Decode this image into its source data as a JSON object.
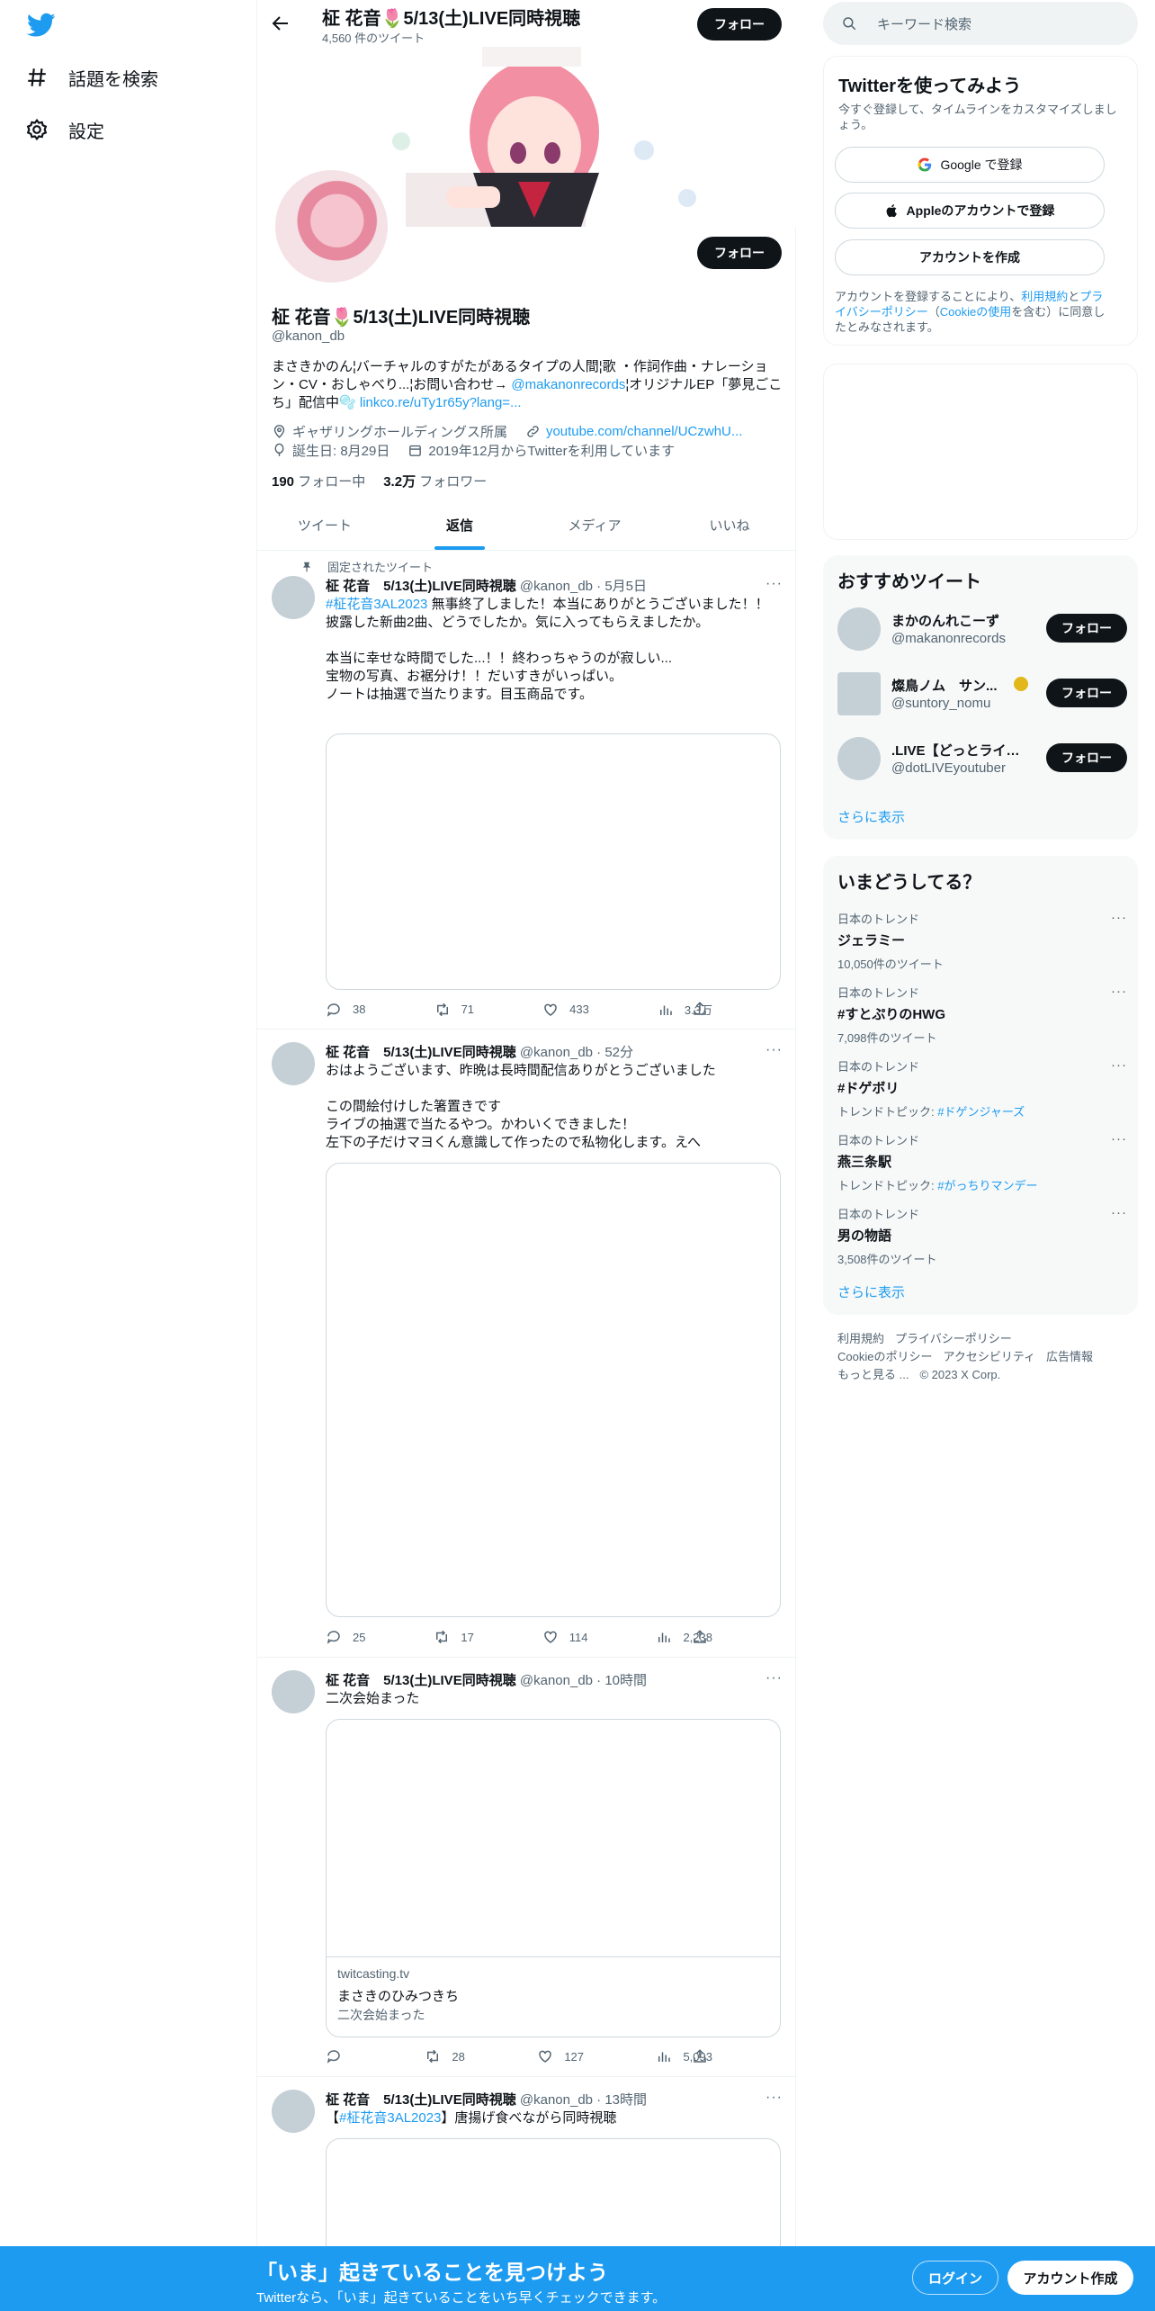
{
  "nav": {
    "explore_label": "話題を検索",
    "settings_label": "設定"
  },
  "header": {
    "name": "柾 花音🌷5/13(土)LIVE同時視聴",
    "tweet_count": "4,560 件のツイート",
    "follow_label": "フォロー"
  },
  "profile": {
    "follow_label": "フォロー",
    "name": "柾 花音🌷5/13(土)LIVE同時視聴",
    "handle": "@kanon_db",
    "bio_1": "まさきかのん¦バーチャルのすがたがあるタイプの人間¦歌 ・作詞作曲・ナレーション・CV・おしゃべり...¦お問い合わせ→ ",
    "bio_mention": "@makanonrecords",
    "bio_2": "¦オリジナルEP「夢見ごこち」配信中🫧 ",
    "bio_link": "linkco.re/uTy1r65y?lang=...",
    "location": "ギャザリングホールディングス所属",
    "website": "youtube.com/channel/UCzwhU...",
    "birthday": "誕生日: 8月29日",
    "joined": "2019年12月からTwitterを利用しています",
    "following_count": "190",
    "following_label": "フォロー中",
    "followers_count": "3.2万",
    "followers_label": "フォロワー"
  },
  "tabs": [
    {
      "label": "ツイート"
    },
    {
      "label": "返信"
    },
    {
      "label": "メディア"
    },
    {
      "label": "いいね"
    }
  ],
  "tweets": [
    {
      "pinned_label": "固定されたツイート",
      "name": "柾 花音　5/13(土)LIVE同時視聴",
      "meta": "@kanon_db · 5月5日",
      "hashtag": "#柾花音3AL2023",
      "body_first": " 無事終了しました！本当にありがとうございました！！",
      "body": "\n披露した新曲2曲、どうでしたか。気に入ってもらえましたか。\n\n本当に幸せな時間でした...！！終わっちゃうのが寂しい...\n宝物の写真、お裾分け！！だいすきがいっぱい。\nノートは抽選で当たります。目玉商品です。",
      "replies": "38",
      "retweets": "71",
      "likes": "433",
      "views": "3.3万"
    },
    {
      "name": "柾 花音　5/13(土)LIVE同時視聴",
      "meta": "@kanon_db · 52分",
      "body": "おはようございます、昨晩は長時間配信ありがとうございました\n\nこの間絵付けした箸置きです\nライブの抽選で当たるやつ。かわいくできました！\n左下の子だけマヨくん意識して作ったので私物化します。えへ",
      "replies": "25",
      "retweets": "17",
      "likes": "114",
      "views": "2,238"
    },
    {
      "name": "柾 花音　5/13(土)LIVE同時視聴",
      "meta": "@kanon_db · 10時間",
      "body": "二次会始まった",
      "card_domain": "twitcasting.tv",
      "card_title": "まさきのひみつきち",
      "card_desc": "二次会始まった",
      "replies": "",
      "retweets": "28",
      "likes": "127",
      "views": "5,093"
    },
    {
      "name": "柾 花音　5/13(土)LIVE同時視聴",
      "meta": "@kanon_db · 13時間",
      "body_pre": "【",
      "hashtag": "#柾花音3AL2023",
      "body_post": "】唐揚げ食べながら同時視聴"
    }
  ],
  "search": {
    "placeholder": "キーワード検索"
  },
  "signup": {
    "title": "Twitterを使ってみよう",
    "subtitle": "今すぐ登録して、タイムラインをカスタマイズしましょう。",
    "google_label": "Google で登録",
    "apple_label": "Appleのアカウントで登録",
    "create_label": "アカウントを作成",
    "terms_pre": "アカウントを登録することにより、",
    "terms_link1": "利用規約",
    "terms_mid1": "と",
    "terms_link2": "プライバシーポリシー",
    "terms_mid2": "（",
    "terms_link3": "Cookieの使用",
    "terms_post": "を含む）に同意したとみなされます。"
  },
  "recommend": {
    "title": "おすすめツイート",
    "users": [
      {
        "name": "まかのんれこーず",
        "handle": "@makanonrecords",
        "follow": "フォロー"
      },
      {
        "name": "燦鳥ノム　サン...",
        "handle": "@suntory_nomu",
        "follow": "フォロー"
      },
      {
        "name": ".LIVE【どっとライブ...",
        "handle": "@dotLIVEyoutuber",
        "follow": "フォロー"
      }
    ],
    "show_more": "さらに表示"
  },
  "trends": {
    "title": "いまどうしてる？",
    "items": [
      {
        "category": "日本のトレンド",
        "title": "ジェラミー",
        "sub": "10,050件のツイート"
      },
      {
        "category": "日本のトレンド",
        "title": "#すとぷりのHWG",
        "sub": "7,098件のツイート"
      },
      {
        "category": "日本のトレンド",
        "title": "#ドゲボリ",
        "sub_pre": "トレンドトピック: ",
        "sub_link": "#ドゲンジャーズ"
      },
      {
        "category": "日本のトレンド",
        "title": "燕三条駅",
        "sub_pre": "トレンドトピック: ",
        "sub_link": "#がっちりマンデー"
      },
      {
        "category": "日本のトレンド",
        "title": "男の物語",
        "sub": "3,508件のツイート"
      }
    ],
    "show_more": "さらに表示"
  },
  "footer": {
    "terms": "利用規約",
    "privacy": "プライバシーポリシー",
    "cookie": "Cookieのポリシー",
    "accessibility": "アクセシビリティ",
    "ads": "広告情報",
    "more": "もっと見る ...",
    "copyright": "© 2023 X Corp."
  },
  "bottom": {
    "title": "「いま」起きていることを見つけよう",
    "subtitle": "Twitterなら、「いま」起きていることをいち早くチェックできます。",
    "login": "ログイン",
    "signup": "アカウント作成"
  },
  "colors": {
    "accent": "#1d9bf0",
    "text": "#0f1419",
    "muted": "#536471",
    "border": "#eff3f4"
  }
}
